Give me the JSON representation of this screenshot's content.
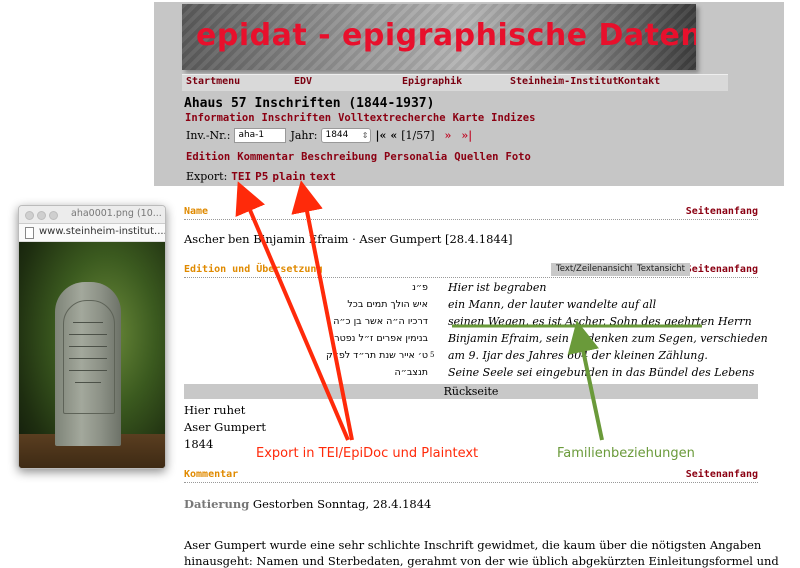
{
  "banner": {
    "title": "epidat - epigraphische Datenbank"
  },
  "nav": {
    "items": [
      "Startmenu",
      "EDV",
      "Epigraphik",
      "Steinheim-Institut",
      "Kontakt"
    ]
  },
  "record": {
    "title": "Ahaus 57 Inschriften (1844-1937)"
  },
  "subnav1": {
    "items": [
      "Information",
      "Inschriften",
      "Volltextrecherche",
      "Karte",
      "Indizes"
    ]
  },
  "inv": {
    "label": "Inv.-Nr.:",
    "value": "aha-1",
    "year_label": "Jahr:",
    "year_value": "1844",
    "first": "|«",
    "prev": "«",
    "page": "[1/57]",
    "next": "»",
    "last": "»|"
  },
  "subnav2": {
    "items": [
      "Edition",
      "Kommentar",
      "Beschreibung",
      "Personalia",
      "Quellen",
      "Foto"
    ]
  },
  "export": {
    "label": "Export:",
    "items": [
      "TEI",
      "P5",
      "plain",
      "text"
    ]
  },
  "sections": {
    "name": {
      "label": "Name",
      "right": "Seitenanfang",
      "text": "Ascher ben Binjamin Efraim · Aser Gumpert [28.4.1844]"
    },
    "edition": {
      "label": "Edition und Übersetzung",
      "right": "Seitenanfang",
      "tab1": "Text/Zeilenansicht",
      "tab2": "Textansicht"
    },
    "kommentar": {
      "label": "Kommentar",
      "right": "Seitenanfang"
    }
  },
  "inscription": [
    {
      "hebrew": "פ״נ",
      "german": "Hier ist begraben",
      "ln": ""
    },
    {
      "hebrew": "איש הולך תמים בכל",
      "german": "ein Mann, der lauter wandelte auf all",
      "ln": ""
    },
    {
      "hebrew": "דרכיו ה״ה אשר בן כ״ה",
      "german": "seinen Wegen, es ist Ascher, Sohn des geehrten Herrn",
      "ln": ""
    },
    {
      "hebrew": "בנימין אפרים ז״ל נפטר",
      "german": "Binjamin Efraim, sein Andenken zum Segen, verschieden",
      "ln": ""
    },
    {
      "hebrew": "ט׳ אייר שנת תר״ד לפ״ק",
      "german": "am 9. Ijar des Jahres 604 der kleinen Zählung.",
      "ln": "5"
    },
    {
      "hebrew": "תנצב״ה",
      "german": "Seine Seele sei eingebunden in das Bündel des Lebens",
      "ln": ""
    }
  ],
  "rueckseite": {
    "label": "Rückseite",
    "lines": [
      "Hier ruhet",
      "Aser Gumpert",
      "1844"
    ]
  },
  "datierung": {
    "label": "Datierung",
    "text": "Gestorben Sonntag, 28.4.1844"
  },
  "comment": {
    "line1": "Aser Gumpert wurde eine sehr schlichte Inschrift gewidmet, die kaum über die nötigsten Angaben",
    "line2": "hinausgeht: Namen und Sterbedaten, gerahmt von der wie üblich abgekürzten Einleitungsformel und"
  },
  "popup": {
    "title": "aha0001.png (10...",
    "url": "www.steinheim-institut...."
  },
  "annotations": {
    "export": "Export in TEI/EpiDoc und Plaintext",
    "family": "Familienbeziehungen"
  },
  "colors": {
    "arrow_red": "#ff2a0a",
    "arrow_green": "#6a9a3a",
    "link_dark_red": "#8b0012",
    "section_orange": "#e08a00",
    "banner_red": "#e8102c"
  }
}
